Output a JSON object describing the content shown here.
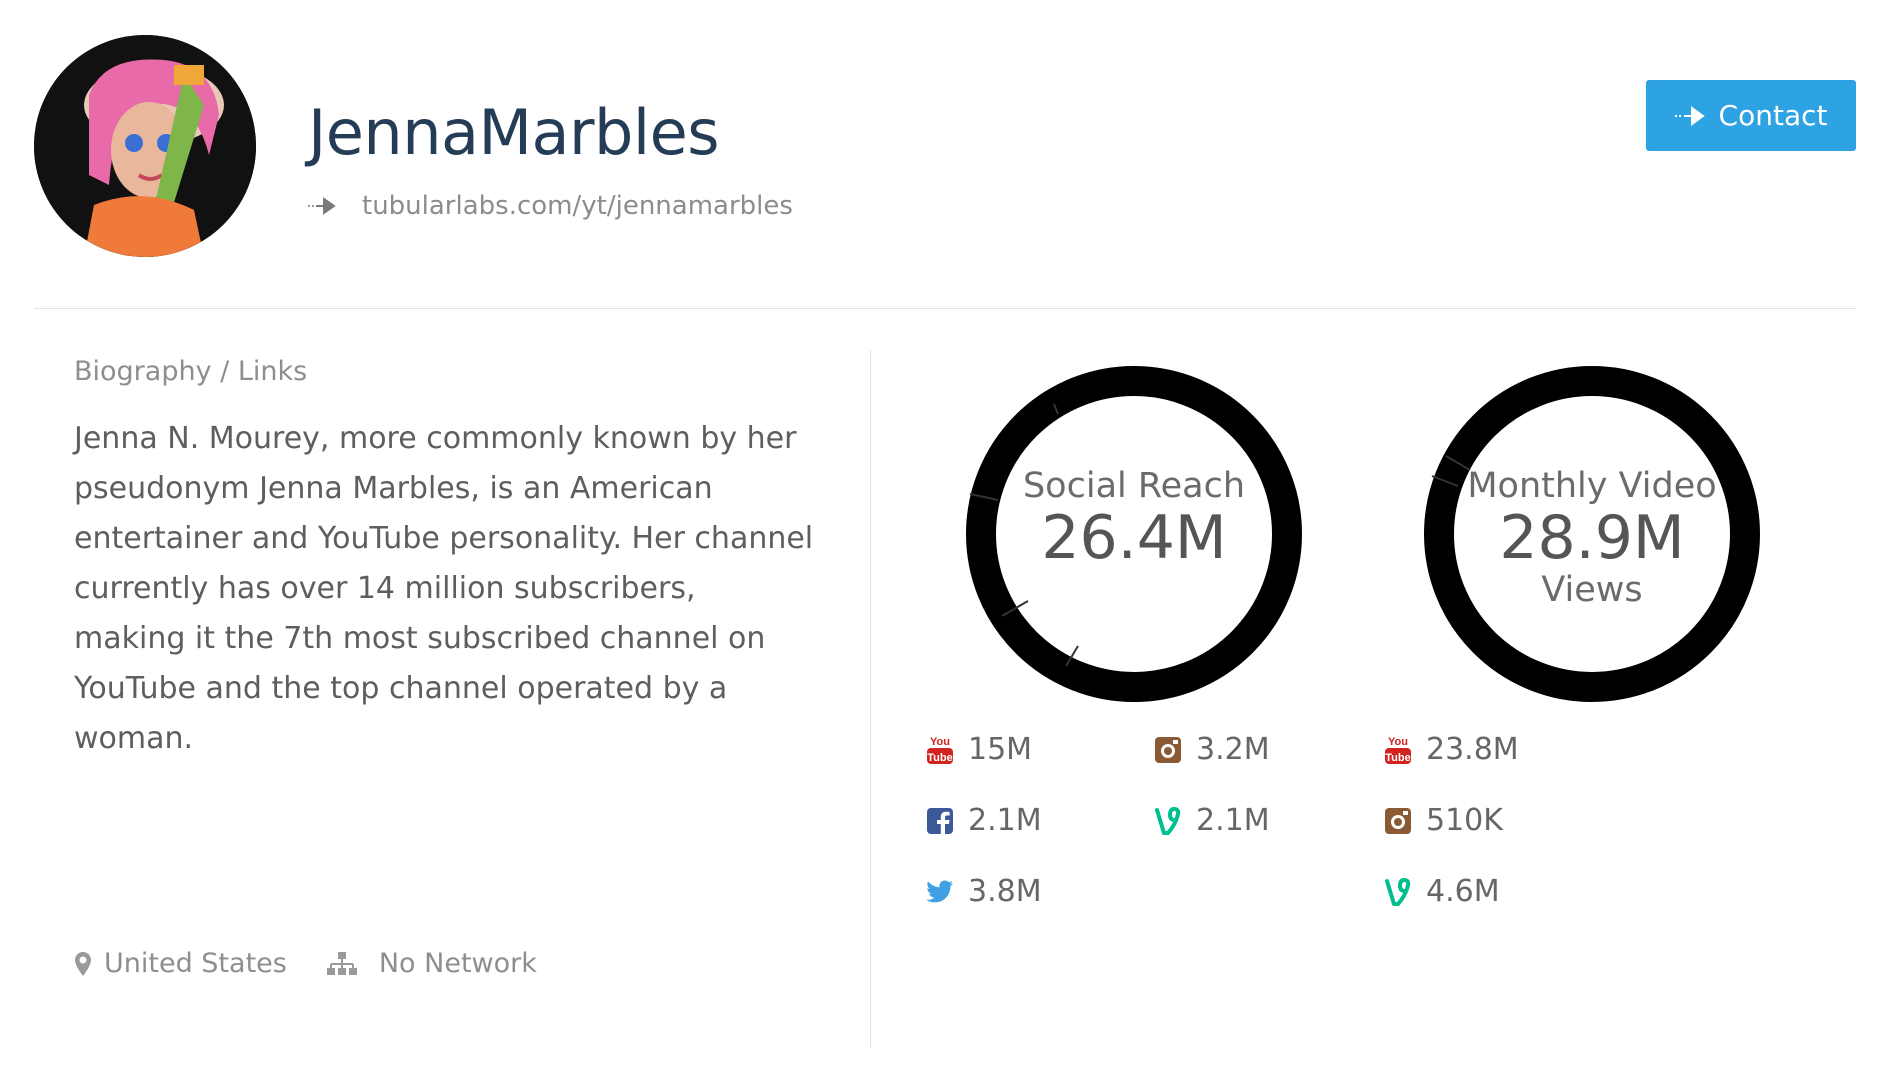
{
  "profile": {
    "name": "JennaMarbles",
    "url": "tubularlabs.com/yt/jennamarbles"
  },
  "contact": {
    "label": "Contact"
  },
  "bio": {
    "heading": "Biography / Links",
    "text": "Jenna N. Mourey, more commonly known by her pseudonym Jenna Marbles, is an American entertainer and YouTube personality. Her channel currently has over 14 million subscribers, making it the 7th most subscribed channel on YouTube and the top channel operated by a woman."
  },
  "meta": {
    "location": "United States",
    "network": "No Network"
  },
  "social_reach": {
    "title": "Social Reach",
    "value": "26.4M",
    "breakdown": [
      {
        "icon": "youtube-icon",
        "value": "15M"
      },
      {
        "icon": "instagram-icon",
        "value": "3.2M"
      },
      {
        "icon": "facebook-icon",
        "value": "2.1M"
      },
      {
        "icon": "vine-icon",
        "value": "2.1M"
      },
      {
        "icon": "twitter-icon",
        "value": "3.8M"
      }
    ]
  },
  "monthly_views": {
    "title": "Monthly Video",
    "value": "28.9M",
    "subtitle": "Views",
    "breakdown": [
      {
        "icon": "youtube-icon",
        "value": "23.8M"
      },
      {
        "icon": "instagram-icon",
        "value": "510K"
      },
      {
        "icon": "vine-icon",
        "value": "4.6M"
      }
    ]
  },
  "colors": {
    "accent": "#2ea3e3",
    "title": "#243c56",
    "youtube": "#d1231f",
    "instagram": "#8a5a35",
    "facebook": "#3b5998",
    "vine": "#00bf8f",
    "twitter": "#3fa0e4"
  }
}
